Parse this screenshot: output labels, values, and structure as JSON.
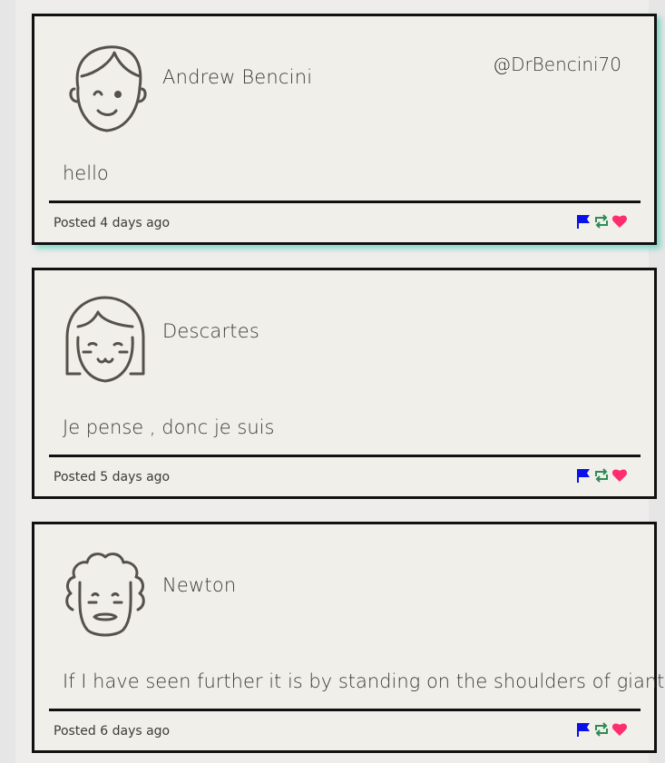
{
  "tweets": [
    {
      "name": "Andrew Bencini",
      "handle": "@DrBencini70",
      "text": "hello",
      "posted": "Posted 4 days ago",
      "avatar": "boy-avatar-icon"
    },
    {
      "name": "Descartes",
      "handle": "",
      "text": "Je pense , donc je suis",
      "posted": "Posted 5 days ago",
      "avatar": "girl-avatar-icon"
    },
    {
      "name": "Newton",
      "handle": "",
      "text": "If I have seen further it is by standing on the shoulders of giants",
      "posted": "Posted 6 days ago",
      "avatar": "curly-hair-avatar-icon"
    }
  ],
  "icons": {
    "flag": "flag-icon",
    "retweet": "retweet-icon",
    "like": "heart-icon"
  },
  "colors": {
    "flag": "#0a10e8",
    "retweet": "#2e8b57",
    "like": "#ff2d6f",
    "border": "#111111",
    "highlight": "#2ec8aa"
  }
}
